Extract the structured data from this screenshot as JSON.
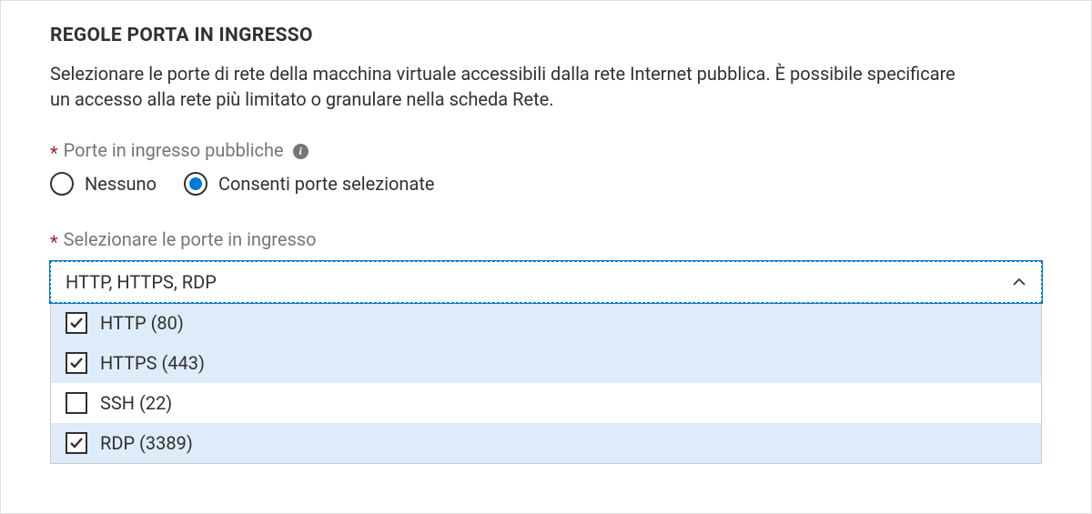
{
  "section": {
    "title": "REGOLE PORTA IN INGRESSO",
    "description": "Selezionare le porte di rete della macchina virtuale accessibili dalla rete Internet pubblica. È possibile specificare un accesso alla rete più limitato o granulare nella scheda Rete."
  },
  "public_ports": {
    "required_mark": "*",
    "label": "Porte in ingresso pubbliche",
    "info_glyph": "i",
    "options": [
      {
        "id": "none",
        "label": "Nessuno",
        "checked": false
      },
      {
        "id": "allow-selected",
        "label": "Consenti porte selezionate",
        "checked": true
      }
    ]
  },
  "select_ports": {
    "required_mark": "*",
    "label": "Selezionare le porte in ingresso",
    "value": "HTTP, HTTPS, RDP",
    "options": [
      {
        "id": "http",
        "label": "HTTP (80)",
        "selected": true
      },
      {
        "id": "https",
        "label": "HTTPS (443)",
        "selected": true
      },
      {
        "id": "ssh",
        "label": "SSH (22)",
        "selected": false
      },
      {
        "id": "rdp",
        "label": "RDP (3389)",
        "selected": true
      }
    ]
  }
}
